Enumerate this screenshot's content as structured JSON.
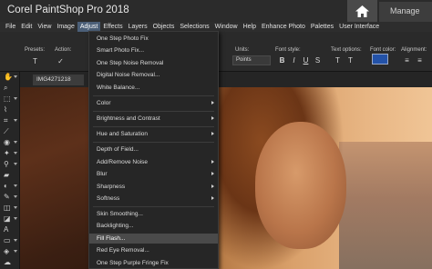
{
  "app": {
    "title": "Corel PaintShop Pro 2018",
    "manage_tab": "Manage"
  },
  "menubar": {
    "items": [
      "File",
      "Edit",
      "View",
      "Image",
      "Adjust",
      "Effects",
      "Layers",
      "Objects",
      "Selections",
      "Window",
      "Help",
      "Enhance Photo",
      "Palettes",
      "User Interface"
    ],
    "active": "Adjust"
  },
  "options": {
    "presets_label": "Presets:",
    "action_label": "Action:",
    "units_label": "Units:",
    "units_value": "Points",
    "font_style_label": "Font style:",
    "text_options_label": "Text options:",
    "font_color_label": "Font color:",
    "font_color": "#2352a8",
    "alignment_label": "Alignment:"
  },
  "document": {
    "tab": "IMG4271218"
  },
  "adjust_menu": {
    "items": [
      {
        "label": "One Step Photo Fix",
        "submenu": false
      },
      {
        "label": "Smart Photo Fix...",
        "submenu": false
      },
      {
        "label": "One Step Noise Removal",
        "submenu": false
      },
      {
        "label": "Digital Noise Removal...",
        "submenu": false
      },
      {
        "label": "White Balance...",
        "submenu": false
      },
      {
        "label": "Color",
        "submenu": true
      },
      {
        "label": "Brightness and Contrast",
        "submenu": true
      },
      {
        "label": "Hue and Saturation",
        "submenu": true
      },
      {
        "label": "Depth of Field...",
        "submenu": false
      },
      {
        "label": "Add/Remove Noise",
        "submenu": true
      },
      {
        "label": "Blur",
        "submenu": true
      },
      {
        "label": "Sharpness",
        "submenu": true
      },
      {
        "label": "Softness",
        "submenu": true
      },
      {
        "label": "Skin Smoothing...",
        "submenu": false
      },
      {
        "label": "Backlighting...",
        "submenu": false
      },
      {
        "label": "Fill Flash...",
        "submenu": false,
        "highlighted": true
      },
      {
        "label": "Red Eye Removal...",
        "submenu": false
      },
      {
        "label": "One Step Purple Fringe Fix",
        "submenu": false
      }
    ]
  },
  "tools": [
    "pan-tool",
    "zoom-tool",
    "selection-tool",
    "freehand-selection-tool",
    "move-tool",
    "crop-tool",
    "straighten-tool",
    "red-eye-tool",
    "makeover-tool",
    "clone-brush-tool",
    "scratch-remover-tool",
    "object-remover-tool",
    "paint-brush-tool",
    "eraser-tool",
    "fill-tool",
    "text-tool",
    "shape-tool",
    "color-changer-tool"
  ]
}
